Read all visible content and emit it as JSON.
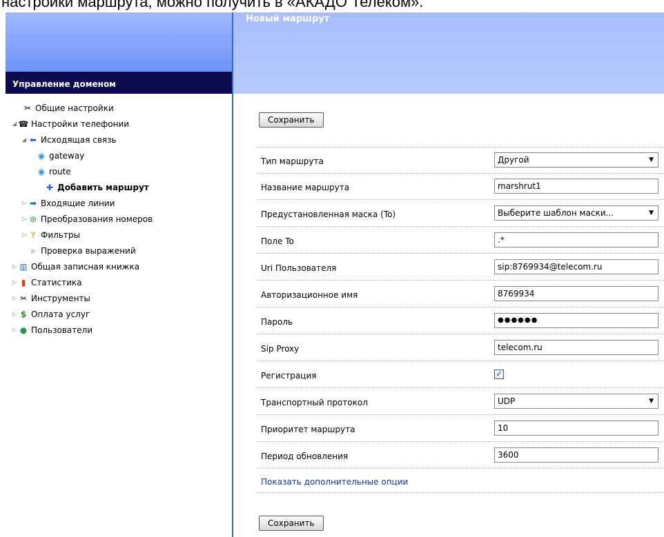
{
  "caption": "настройки маршрута, можно получить в «АКАДО Телеком».",
  "sidebar": {
    "header": "Управление доменом",
    "items": [
      {
        "label": "Общие настройки",
        "icon": "tools-icon"
      },
      {
        "label": "Настройки телефонии",
        "icon": "phone-settings-icon"
      },
      {
        "label": "Исходящая связь",
        "icon": "outgoing-arrow-icon"
      },
      {
        "label": "gateway",
        "icon": "gateway-icon"
      },
      {
        "label": "route",
        "icon": "route-icon"
      },
      {
        "label": "Добавить маршрут",
        "icon": "plus-icon"
      },
      {
        "label": "Входящие линии",
        "icon": "incoming-arrow-icon"
      },
      {
        "label": "Преобразования номеров",
        "icon": "transform-icon"
      },
      {
        "label": "Фильтры",
        "icon": "filter-icon"
      },
      {
        "label": "Проверка выражений",
        "icon": "magnifier-icon"
      },
      {
        "label": "Общая записная книжка",
        "icon": "book-icon"
      },
      {
        "label": "Статистика",
        "icon": "chart-icon"
      },
      {
        "label": "Инструменты",
        "icon": "tools-icon"
      },
      {
        "label": "Оплата услуг",
        "icon": "dollar-icon"
      },
      {
        "label": "Пользователи",
        "icon": "users-icon"
      }
    ]
  },
  "main": {
    "title": "Новый маршрут",
    "save_label": "Сохранить",
    "fields": [
      {
        "label": "Тип маршрута",
        "value": "Другой"
      },
      {
        "label": "Название маршрута",
        "value": "marshrut1"
      },
      {
        "label": "Предустановленная маска (To)",
        "value": "Выберите шаблон маски..."
      },
      {
        "label": "Поле To",
        "value": ".*"
      },
      {
        "label": "Uri Пользователя",
        "value": "sip:8769934@telecom.ru"
      },
      {
        "label": "Авторизационное имя",
        "value": "8769934"
      },
      {
        "label": "Пароль",
        "value": "●●●●●●"
      },
      {
        "label": "Sip Proxy",
        "value": "telecom.ru"
      },
      {
        "label": "Регистрация",
        "value": true
      },
      {
        "label": "Транспортный протокол",
        "value": "UDP"
      },
      {
        "label": "Приоритет маршрута",
        "value": "10"
      },
      {
        "label": "Период обновления",
        "value": "3600"
      }
    ],
    "more_options_link": "Показать дополнительные опции"
  },
  "colors": {
    "header_dark": "#0d0c4f",
    "banner_blue": "#7d9ffa",
    "link": "#0a36b8"
  }
}
